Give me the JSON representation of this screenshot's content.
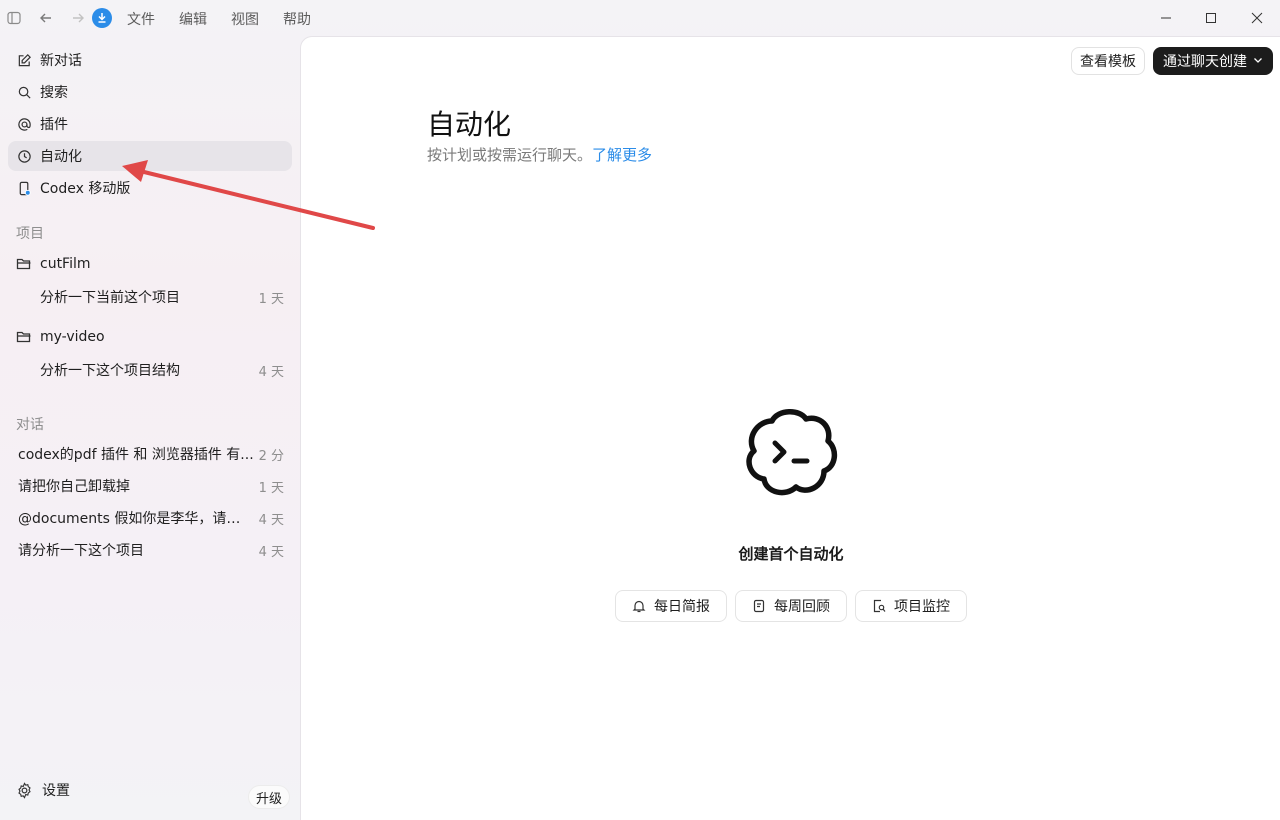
{
  "titlebar": {
    "menu": [
      "文件",
      "编辑",
      "视图",
      "帮助"
    ]
  },
  "sidebar": {
    "nav": [
      {
        "label": "新对话",
        "icon": "edit-icon"
      },
      {
        "label": "搜索",
        "icon": "search-icon"
      },
      {
        "label": "插件",
        "icon": "at-icon"
      },
      {
        "label": "自动化",
        "icon": "clock-icon",
        "active": true
      },
      {
        "label": "Codex 移动版",
        "icon": "mobile-icon"
      }
    ],
    "projects_label": "项目",
    "projects": [
      {
        "name": "cutFilm",
        "threads": [
          {
            "title": "分析一下当前这个项目",
            "ago": "1 天"
          }
        ]
      },
      {
        "name": "my-video",
        "threads": [
          {
            "title": "分析一下这个项目结构",
            "ago": "4 天"
          }
        ]
      }
    ],
    "chats_label": "对话",
    "chats": [
      {
        "title": "codex的pdf 插件 和 浏览器插件 有...",
        "ago": "2 分"
      },
      {
        "title": "请把你自己卸载掉",
        "ago": "1 天"
      },
      {
        "title": "@documents 假如你是李华，请写一...",
        "ago": "4 天"
      },
      {
        "title": "请分析一下这个项目",
        "ago": "4 天"
      }
    ],
    "settings_label": "设置",
    "upgrade_label": "升级"
  },
  "main": {
    "view_templates": "查看模板",
    "create_via_chat": "通过聊天创建",
    "title": "自动化",
    "subtitle": "按计划或按需运行聊天。",
    "learn_more": "了解更多",
    "empty_title": "创建首个自动化",
    "chips": [
      {
        "label": "每日简报",
        "icon": "bell-icon"
      },
      {
        "label": "每周回顾",
        "icon": "notebook-icon"
      },
      {
        "label": "项目监控",
        "icon": "file-search-icon"
      }
    ]
  },
  "colors": {
    "accent_link": "#2b8ce8",
    "annotation_arrow": "#e04848",
    "dark_button": "#1c1c1c"
  }
}
